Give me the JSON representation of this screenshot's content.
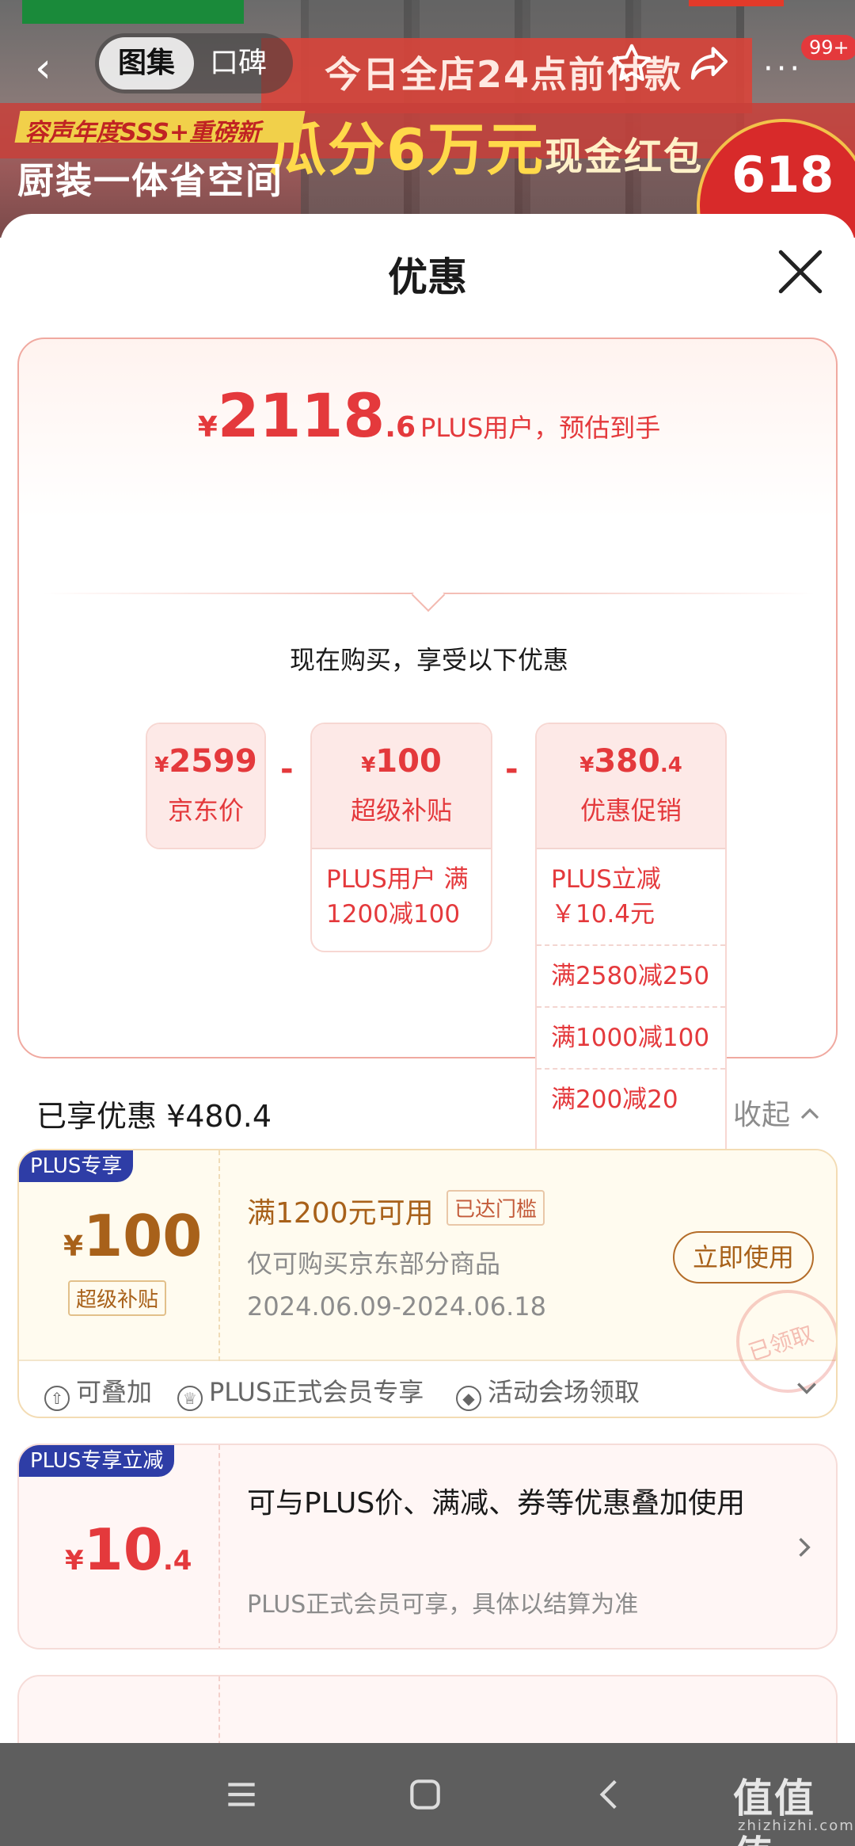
{
  "banner": {
    "tabs": [
      "图集",
      "口碑"
    ],
    "promo_line1": "今日全店24点前付款",
    "promo_line2": "瓜分6万元",
    "promo_line2_suffix": "现金红包",
    "yellow_tag": "容声年度SSS+重磅新",
    "slogan": "厨装一体省空间",
    "badge": "618",
    "notification_count": "99+"
  },
  "sheet": {
    "title": "优惠"
  },
  "summary": {
    "yen": "¥",
    "price_int": "2118",
    "price_dec": ".6",
    "price_desc": "PLUS用户，预估到手",
    "enjoy_text": "现在购买，享受以下优惠",
    "minus": "-",
    "cards": [
      {
        "yen": "¥",
        "amount": "2599",
        "label": "京东价",
        "rows": []
      },
      {
        "yen": "¥",
        "amount": "100",
        "label": "超级补贴",
        "rows": [
          "PLUS用户 满1200减100"
        ]
      },
      {
        "yen": "¥",
        "amount": "380",
        "amount_dec": ".4",
        "label": "优惠促销",
        "rows": [
          "PLUS立减 ￥10.4元",
          "满2580减250",
          "满1000减100",
          "满200减20"
        ]
      }
    ]
  },
  "enjoyed": {
    "text": "已享优惠 ¥480.4",
    "collapse": "收起"
  },
  "coupon1": {
    "tag": "PLUS专享",
    "yen": "¥",
    "amount": "100",
    "amount_label": "超级补贴",
    "condition": "满1200元可用",
    "reached": "已达门槛",
    "scope": "仅可购买京东部分商品",
    "date": "2024.06.09-2024.06.18",
    "use_button": "立即使用",
    "stamp": "已领取",
    "features": [
      "可叠加",
      "PLUS正式会员专享",
      "活动会场领取"
    ]
  },
  "coupon2": {
    "tag": "PLUS专享立减",
    "yen": "¥",
    "amount_int": "10",
    "amount_dec": ".4",
    "text": "可与PLUS价、满减、券等优惠叠加使用",
    "sub": "PLUS正式会员可享，具体以结算为准"
  },
  "watermark": {
    "main": "值值值",
    "sub": "zhizhizhi.com"
  }
}
